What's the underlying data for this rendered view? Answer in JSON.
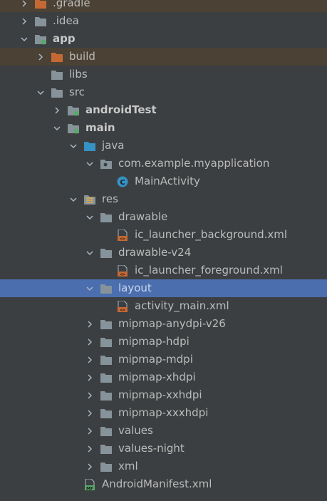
{
  "tree": [
    {
      "id": "gradle",
      "label": ".gradle",
      "depth": 0,
      "arrow": "right",
      "icon": "folder-orange",
      "style": "excluded"
    },
    {
      "id": "idea",
      "label": ".idea",
      "depth": 0,
      "arrow": "right",
      "icon": "folder"
    },
    {
      "id": "app",
      "label": "app",
      "depth": 0,
      "arrow": "down",
      "icon": "module",
      "bold": true
    },
    {
      "id": "build",
      "label": "build",
      "depth": 1,
      "arrow": "right",
      "icon": "folder-orange",
      "style": "excluded"
    },
    {
      "id": "libs",
      "label": "libs",
      "depth": 1,
      "arrow": "none",
      "icon": "folder"
    },
    {
      "id": "src",
      "label": "src",
      "depth": 1,
      "arrow": "down",
      "icon": "folder"
    },
    {
      "id": "androidTest",
      "label": "androidTest",
      "depth": 2,
      "arrow": "right",
      "icon": "module",
      "bold": true
    },
    {
      "id": "main",
      "label": "main",
      "depth": 2,
      "arrow": "down",
      "icon": "module",
      "bold": true
    },
    {
      "id": "java",
      "label": "java",
      "depth": 3,
      "arrow": "down",
      "icon": "folder-blue"
    },
    {
      "id": "package",
      "label": "com.example.myapplication",
      "depth": 4,
      "arrow": "down",
      "icon": "package"
    },
    {
      "id": "mainactivity",
      "label": "MainActivity",
      "depth": 5,
      "arrow": "none",
      "icon": "class"
    },
    {
      "id": "res",
      "label": "res",
      "depth": 3,
      "arrow": "down",
      "icon": "folder-res"
    },
    {
      "id": "drawable",
      "label": "drawable",
      "depth": 4,
      "arrow": "down",
      "icon": "folder"
    },
    {
      "id": "ic_bg",
      "label": "ic_launcher_background.xml",
      "depth": 5,
      "arrow": "none",
      "icon": "xml"
    },
    {
      "id": "drawable_v24",
      "label": "drawable-v24",
      "depth": 4,
      "arrow": "down",
      "icon": "folder"
    },
    {
      "id": "ic_fg",
      "label": "ic_launcher_foreground.xml",
      "depth": 5,
      "arrow": "none",
      "icon": "xml"
    },
    {
      "id": "layout",
      "label": "layout",
      "depth": 4,
      "arrow": "down",
      "icon": "folder",
      "style": "selected"
    },
    {
      "id": "activity_main",
      "label": "activity_main.xml",
      "depth": 5,
      "arrow": "none",
      "icon": "xml"
    },
    {
      "id": "mipmap_anydpi",
      "label": "mipmap-anydpi-v26",
      "depth": 4,
      "arrow": "right",
      "icon": "folder"
    },
    {
      "id": "mipmap_hdpi",
      "label": "mipmap-hdpi",
      "depth": 4,
      "arrow": "right",
      "icon": "folder"
    },
    {
      "id": "mipmap_mdpi",
      "label": "mipmap-mdpi",
      "depth": 4,
      "arrow": "right",
      "icon": "folder"
    },
    {
      "id": "mipmap_xhdpi",
      "label": "mipmap-xhdpi",
      "depth": 4,
      "arrow": "right",
      "icon": "folder"
    },
    {
      "id": "mipmap_xxhdpi",
      "label": "mipmap-xxhdpi",
      "depth": 4,
      "arrow": "right",
      "icon": "folder"
    },
    {
      "id": "mipmap_xxxhdpi",
      "label": "mipmap-xxxhdpi",
      "depth": 4,
      "arrow": "right",
      "icon": "folder"
    },
    {
      "id": "values",
      "label": "values",
      "depth": 4,
      "arrow": "right",
      "icon": "folder"
    },
    {
      "id": "values_night",
      "label": "values-night",
      "depth": 4,
      "arrow": "right",
      "icon": "folder"
    },
    {
      "id": "xml",
      "label": "xml",
      "depth": 4,
      "arrow": "right",
      "icon": "folder"
    },
    {
      "id": "manifest",
      "label": "AndroidManifest.xml",
      "depth": 3,
      "arrow": "none",
      "icon": "manifest"
    }
  ],
  "colors": {
    "background": "#3c3f41",
    "selected": "#4b6eaf",
    "excluded": "#4b4235",
    "folder": "#87939a",
    "folder_orange": "#c56934",
    "folder_blue": "#3592c4",
    "class_icon": "#3592c4",
    "module_dot": "#59a869"
  }
}
